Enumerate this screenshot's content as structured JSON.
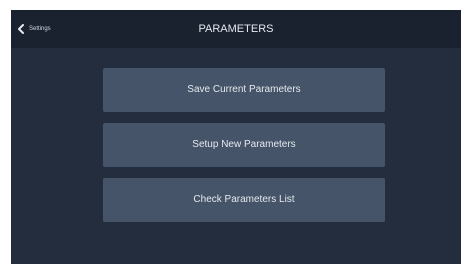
{
  "header": {
    "back_label": "Settings",
    "title": "PARAMETERS"
  },
  "icons": {
    "back": "chevron-left-icon"
  },
  "menu": {
    "items": [
      {
        "label": "Save Current Parameters"
      },
      {
        "label": "Setup New Parameters"
      },
      {
        "label": "Check Parameters List"
      }
    ]
  },
  "colors": {
    "background": "#232d3d",
    "topbar": "#1a222f",
    "button": "#455468",
    "text": "#e4e9ef"
  }
}
